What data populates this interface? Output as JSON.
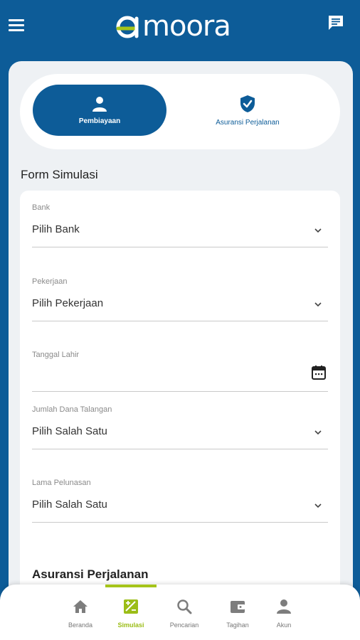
{
  "header": {
    "logo_text": "moora",
    "logo_brand": "amoora",
    "accent_color": "#a5c41a",
    "primary_color": "#0d5c98"
  },
  "tabs": [
    {
      "label": "Pembiayaan",
      "icon": "person-icon",
      "active": true
    },
    {
      "label": "Asuransi Perjalanan",
      "icon": "shield-check-icon",
      "active": false
    }
  ],
  "form": {
    "title": "Form Simulasi",
    "fields": [
      {
        "label": "Bank",
        "value": "Pilih Bank",
        "type": "select"
      },
      {
        "label": "Pekerjaan",
        "value": "Pilih Pekerjaan",
        "type": "select"
      },
      {
        "label": "Tanggal Lahir",
        "value": "",
        "type": "date"
      },
      {
        "label": "Jumlah Dana Talangan",
        "value": "Pilih Salah Satu",
        "type": "select"
      },
      {
        "label": "Lama Pelunasan",
        "value": "Pilih Salah Satu",
        "type": "select"
      }
    ],
    "section_title": "Asuransi Perjalanan"
  },
  "bottom_nav": [
    {
      "label": "Beranda",
      "icon": "home-icon",
      "active": false
    },
    {
      "label": "Simulasi",
      "icon": "simulation-icon",
      "active": true
    },
    {
      "label": "Pencarian",
      "icon": "search-icon",
      "active": false
    },
    {
      "label": "Tagihan",
      "icon": "wallet-icon",
      "active": false
    },
    {
      "label": "Akun",
      "icon": "account-icon",
      "active": false
    }
  ]
}
